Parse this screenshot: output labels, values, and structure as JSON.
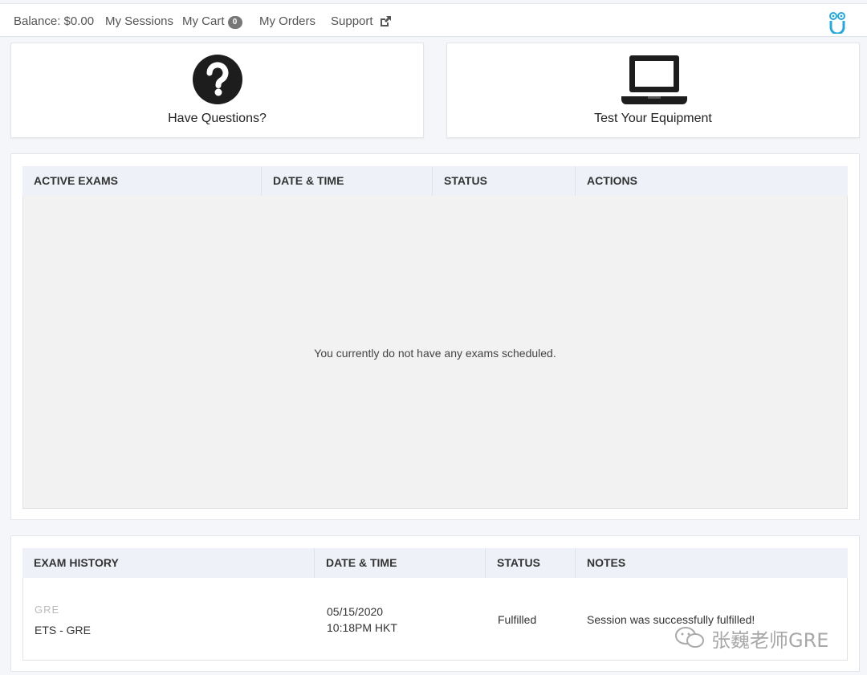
{
  "nav": {
    "balance": "Balance: $0.00",
    "sessions": "My Sessions",
    "cart": "My Cart",
    "cart_count": "0",
    "orders": "My Orders",
    "support": "Support"
  },
  "cards": {
    "questions": "Have Questions?",
    "equipment": "Test Your Equipment"
  },
  "active_exams": {
    "headers": [
      "ACTIVE EXAMS",
      "DATE & TIME",
      "STATUS",
      "ACTIONS"
    ],
    "empty_message": "You currently do not have any exams scheduled."
  },
  "exam_history": {
    "headers": [
      "EXAM HISTORY",
      "DATE & TIME",
      "STATUS",
      "NOTES"
    ],
    "rows": [
      {
        "exam_line1": "GRE",
        "exam_line2": "ETS - GRE",
        "date": "05/15/2020",
        "time": "10:18PM HKT",
        "status": "Fulfilled",
        "notes": "Session was successfully fulfilled!"
      }
    ]
  },
  "watermark": "张巍老师GRE",
  "colors": {
    "accent_logo": "#29a8d8",
    "header_bg": "#eef2f8",
    "empty_bg": "#f2f2f2"
  }
}
